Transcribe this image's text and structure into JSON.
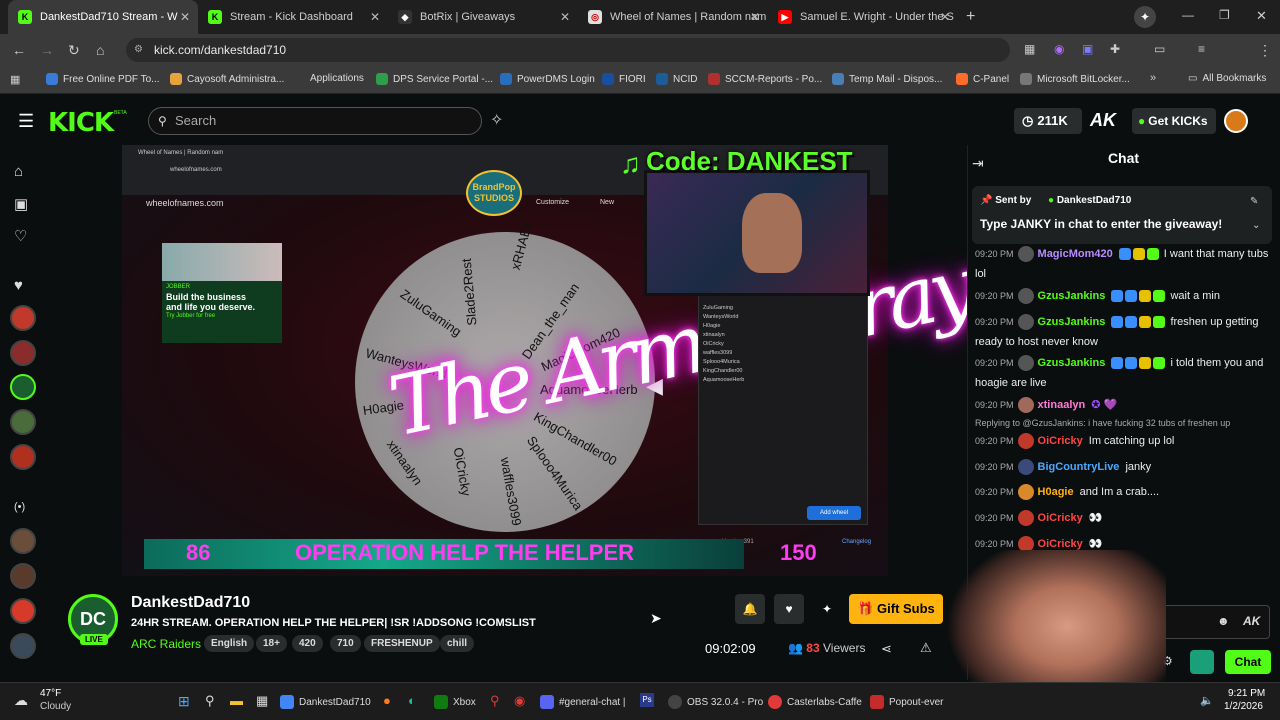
{
  "browser": {
    "tabs": [
      {
        "label": "DankestDad710 Stream - W",
        "color": "#53fc18",
        "fav": "K",
        "active": true
      },
      {
        "label": "Stream - Kick Dashboard",
        "color": "#53fc18",
        "fav": "K",
        "active": false
      },
      {
        "label": "BotRix | Giveaways",
        "color": "#333333",
        "fav": "◆",
        "active": false
      },
      {
        "label": "Wheel of Names | Random nam",
        "color": "#e0e0e0",
        "fav": "◎",
        "active": false
      },
      {
        "label": "Samuel E. Wright - Under the S",
        "color": "#ff0000",
        "fav": "▶",
        "active": false
      }
    ],
    "url": "kick.com/dankestdad710",
    "bookmarks": [
      {
        "label": "Free Online PDF To...",
        "color": "#3a7bd5"
      },
      {
        "label": "Cayosoft Administra...",
        "color": "#e6a23c"
      },
      {
        "label": "Applications",
        "color": "#3a3a3a"
      },
      {
        "label": "DPS Service Portal -...",
        "color": "#2e9e4a"
      },
      {
        "label": "PowerDMS Login",
        "color": "#2a6ebb"
      },
      {
        "label": "FIORI",
        "color": "#1a4fa0"
      },
      {
        "label": "NCID",
        "color": "#1c5d99"
      },
      {
        "label": "SCCM-Reports - Po...",
        "color": "#b03030"
      },
      {
        "label": "Temp Mail - Dispos...",
        "color": "#4a7fb5"
      },
      {
        "label": "C-Panel",
        "color": "#ff6c2c"
      },
      {
        "label": "Microsoft BitLocker...",
        "color": "#777777"
      },
      {
        "label": "All Bookmarks",
        "color": "#3a3a3a"
      }
    ]
  },
  "kick": {
    "logo": "KICK",
    "beta": "BETA",
    "search_placeholder": "Search",
    "balance": "211K",
    "get_kicks": "Get KICKs"
  },
  "video": {
    "inner_url": "wheelofnames.com",
    "inner_tab": "Wheel of Names | Random nam",
    "customize": "Customize",
    "new": "New",
    "code_banner": "Code: DANKEST",
    "brandpop": "BrandPop STUDIOS",
    "jobber": {
      "brand": "JOBBER",
      "line1": "Build the business",
      "line2": "and life you deserve.",
      "cta": "Try Jobber for free"
    },
    "wheel_names": [
      "xRHAEx",
      "Slade2Rest",
      "Dean_the_man",
      "ZuluGaming",
      "MagicMom420",
      "WanteysWorld",
      "AquamooseHerb",
      "H0agie",
      "KingChandler00",
      "xtinaalyn",
      "Splooo4Murica",
      "OiCricky",
      "waffles3099"
    ],
    "neon_text": "The Armen Tray",
    "entries": [
      "ZuluGaming",
      "WanteysWorld",
      "H0agie",
      "xtinaalyn",
      "OiCricky",
      "waffles3099",
      "Splooo4Murica",
      "KingChandler00",
      "AquamooseHerb"
    ],
    "add_wheel": "Add wheel",
    "version": "Version 391",
    "changelog": "Changelog",
    "ticker_left": "86",
    "ticker_text": "OPERATION HELP THE HELPER",
    "ticker_right": "150"
  },
  "stream": {
    "channel": "DankestDad710",
    "live": "LIVE",
    "title": "24HR STREAM. OPERATION HELP THE HELPER| !SR !ADDSONG !COMSLIST",
    "category": "ARC Raiders",
    "tags": [
      "English",
      "18+",
      "420",
      "710",
      "FRESHENUP",
      "chill"
    ],
    "gift_subs": "Gift Subs",
    "uptime": "09:02:09",
    "viewers_count": "83",
    "viewers_label": "Viewers"
  },
  "chat": {
    "header": "Chat",
    "pinned": {
      "sent_by": "Sent by",
      "user": "DankestDad710",
      "text": "Type JANKY in chat to enter the giveaway!"
    },
    "messages": [
      {
        "time": "09:20 PM",
        "user": "MagicMom420",
        "color": "#b98cff",
        "text": "I want that many tubs lol"
      },
      {
        "time": "09:20 PM",
        "user": "GzusJankins",
        "color": "#53fc18",
        "text": "wait a min"
      },
      {
        "time": "09:20 PM",
        "user": "GzusJankins",
        "color": "#53fc18",
        "text": "freshen up getting ready to host never know"
      },
      {
        "time": "09:20 PM",
        "user": "GzusJankins",
        "color": "#53fc18",
        "text": "i told them you and hoagie are live"
      },
      {
        "time": "09:20 PM",
        "user": "xtinaalyn",
        "color": "#ff7ad9",
        "text": ""
      },
      {
        "time": "09:20 PM",
        "user": "OiCricky",
        "color": "#ff4545",
        "text": "Im catching up lol"
      },
      {
        "time": "09:20 PM",
        "user": "BigCountryLive",
        "color": "#4aa8ff",
        "text": "janky"
      },
      {
        "time": "09:20 PM",
        "user": "H0agie",
        "color": "#ffb30f",
        "text": "and Im a crab...."
      },
      {
        "time": "09:20 PM",
        "user": "OiCricky",
        "color": "#ff4545",
        "text": "👀"
      },
      {
        "time": "09:20 PM",
        "user": "OiCricky",
        "color": "#ff4545",
        "text": "👀"
      }
    ],
    "reply": "Replying to @GzusJankins: i have fucking 32 tubs of freshen up",
    "send": "Chat"
  },
  "taskbar": {
    "weather_temp": "47°F",
    "weather_desc": "Cloudy",
    "items": [
      {
        "label": "DankestDad710",
        "color": "#4285f4"
      },
      {
        "label": "Xbox",
        "color": "#107c10"
      },
      {
        "label": "#general-chat |",
        "color": "#5865f2"
      },
      {
        "label": "OBS 32.0.4 - Pro",
        "color": "#444444"
      },
      {
        "label": "Casterlabs-Caffe",
        "color": "#e03a3a"
      },
      {
        "label": "Popout-ever",
        "color": "#c42b2b"
      }
    ],
    "time": "9:21 PM",
    "date": "1/2/2026"
  }
}
